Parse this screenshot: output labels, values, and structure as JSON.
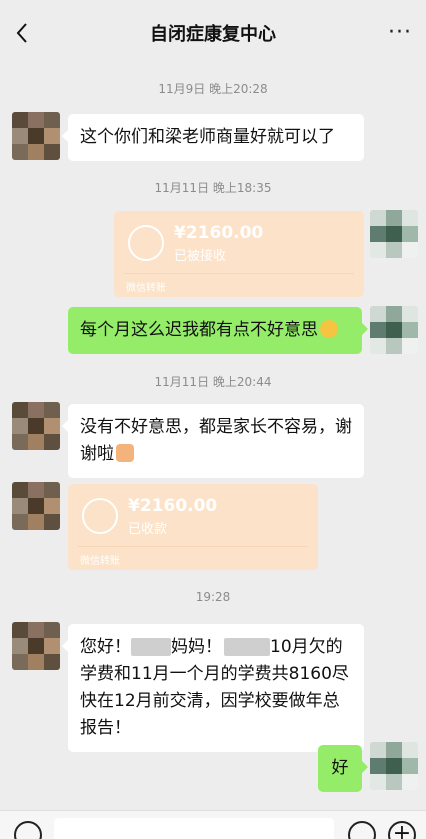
{
  "header": {
    "title": "自闭症康复中心",
    "back_icon": "chevron-left-icon",
    "more_label": "···"
  },
  "messages": {
    "ts1": "11月9日 晚上20:28",
    "m1": "这个你们和梁老师商量好就可以了",
    "ts2": "11月11日 晚上18:35",
    "transfer1": {
      "amount": "¥2160.00",
      "status": "已被接收",
      "footer": "微信转账"
    },
    "m2": "每个月这么迟我都有点不好意思",
    "ts3": "11月11日 晚上20:44",
    "m3": "没有不好意思，都是家长不容易，谢谢啦",
    "transfer2": {
      "amount": "¥2160.00",
      "status": "已收款",
      "footer": "微信转账"
    },
    "ts4": "19:28",
    "m4_a": "您好！",
    "m4_b": "妈妈！",
    "m4_c": "10月欠的学费和11月一个月的学费共8160尽快在12月前交清，因学校要做年总报告！",
    "m5": "好"
  },
  "colors": {
    "bg": "#ededed",
    "left_bubble": "#ffffff",
    "right_bubble": "#95ec69",
    "transfer": "#fbe2c8"
  }
}
